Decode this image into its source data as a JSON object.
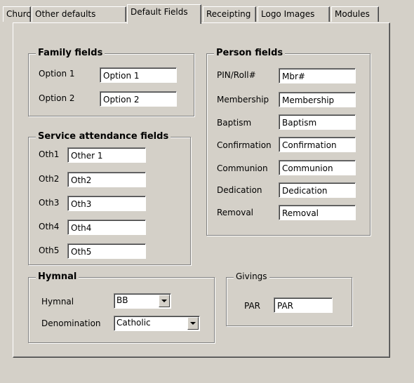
{
  "tabs": [
    {
      "label": "Church"
    },
    {
      "label": "Other defaults"
    },
    {
      "label": "Default Fields"
    },
    {
      "label": "Receipting"
    },
    {
      "label": "Logo Images"
    },
    {
      "label": "Modules"
    }
  ],
  "family_fields": {
    "title": "Family fields",
    "fields": [
      {
        "label": "Option 1",
        "value": "Option 1"
      },
      {
        "label": "Option 2",
        "value": "Option 2"
      }
    ]
  },
  "person_fields": {
    "title": "Person fields",
    "fields": [
      {
        "label": "PIN/Roll#",
        "value": "Mbr#"
      },
      {
        "label": "Membership",
        "value": "Membership"
      },
      {
        "label": "Baptism",
        "value": "Baptism"
      },
      {
        "label": "Confirmation",
        "value": "Confirmation"
      },
      {
        "label": "Communion",
        "value": "Communion"
      },
      {
        "label": "Dedication",
        "value": "Dedication"
      },
      {
        "label": "Removal",
        "value": "Removal"
      }
    ]
  },
  "service_fields": {
    "title": "Service attendance fields",
    "fields": [
      {
        "label": "Oth1",
        "value": "Other 1"
      },
      {
        "label": "Oth2",
        "value": "Oth2"
      },
      {
        "label": "Oth3",
        "value": "Oth3"
      },
      {
        "label": "Oth4",
        "value": "Oth4"
      },
      {
        "label": "Oth5",
        "value": "Oth5"
      }
    ]
  },
  "hymnal": {
    "title": "Hymnal",
    "hymnal_label": "Hymnal",
    "hymnal_value": "BB",
    "denomination_label": "Denomination",
    "denomination_value": "Catholic"
  },
  "givings": {
    "title": "Givings",
    "par_label": "PAR",
    "par_value": "PAR"
  }
}
